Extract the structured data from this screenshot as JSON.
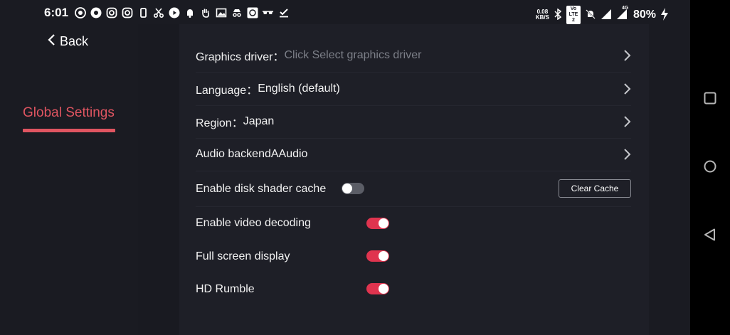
{
  "status_bar": {
    "time": "6:01",
    "net_speed_value": "0.08",
    "net_speed_unit": "KB/S",
    "volte_label": "Vo LTE 2",
    "lte_label": "4G",
    "battery": "80%"
  },
  "sidebar": {
    "back_label": "Back",
    "items": [
      {
        "label": "Global Settings",
        "active": true
      }
    ]
  },
  "settings": {
    "graphics_driver": {
      "label": "Graphics driver：",
      "value": "Click Select graphics driver"
    },
    "language": {
      "label": "Language：",
      "value": "English (default)"
    },
    "region": {
      "label": "Region：",
      "value": "Japan"
    },
    "audio_backend": {
      "label": "Audio backend",
      "value": "AAudio"
    },
    "disk_shader_cache": {
      "label": "Enable disk shader cache",
      "enabled": false,
      "button_label": "Clear Cache"
    },
    "video_decoding": {
      "label": "Enable video decoding",
      "enabled": true
    },
    "full_screen": {
      "label": "Full screen display",
      "enabled": true
    },
    "hd_rumble": {
      "label": "HD Rumble",
      "enabled": true
    }
  },
  "colors": {
    "accent": "#e05561",
    "toggle_on": "#e0344f",
    "toggle_off": "#5b5d66",
    "background": "#1a1b22",
    "panel": "#1e1f27"
  }
}
